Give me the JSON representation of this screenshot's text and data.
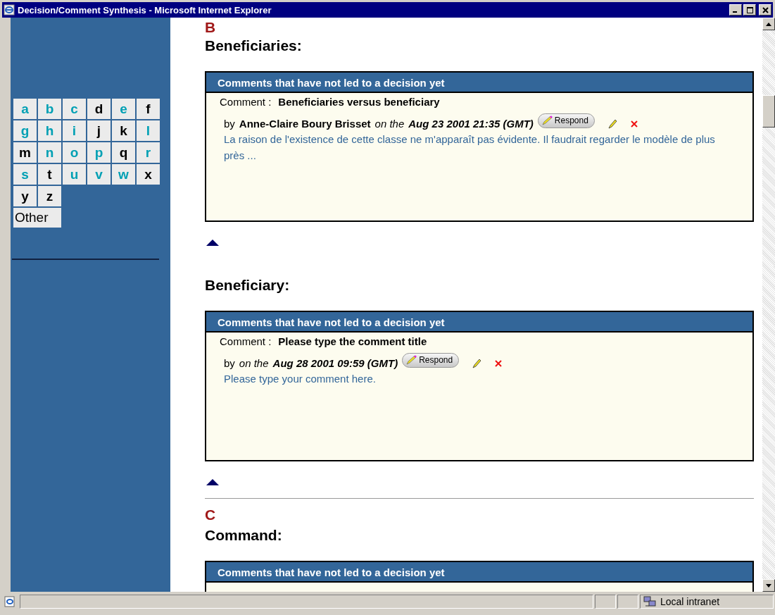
{
  "window": {
    "title": "Decision/Comment Synthesis - Microsoft Internet Explorer"
  },
  "sidebar": {
    "letters": [
      {
        "label": "a",
        "linked": true
      },
      {
        "label": "b",
        "linked": true
      },
      {
        "label": "c",
        "linked": true
      },
      {
        "label": "d",
        "linked": false
      },
      {
        "label": "e",
        "linked": true
      },
      {
        "label": "f",
        "linked": false
      },
      {
        "label": "g",
        "linked": true
      },
      {
        "label": "h",
        "linked": true
      },
      {
        "label": "i",
        "linked": true
      },
      {
        "label": "j",
        "linked": false
      },
      {
        "label": "k",
        "linked": false
      },
      {
        "label": "l",
        "linked": true
      },
      {
        "label": "m",
        "linked": false
      },
      {
        "label": "n",
        "linked": true
      },
      {
        "label": "o",
        "linked": true
      },
      {
        "label": "p",
        "linked": true
      },
      {
        "label": "q",
        "linked": false
      },
      {
        "label": "r",
        "linked": true
      },
      {
        "label": "s",
        "linked": true
      },
      {
        "label": "t",
        "linked": false
      },
      {
        "label": "u",
        "linked": true
      },
      {
        "label": "v",
        "linked": true
      },
      {
        "label": "w",
        "linked": true
      },
      {
        "label": "x",
        "linked": false
      },
      {
        "label": "y",
        "linked": false
      },
      {
        "label": "z",
        "linked": false
      }
    ],
    "other": "Other"
  },
  "sections": [
    {
      "letter": "B",
      "title": "Beneficiaries:",
      "box": {
        "header": "Comments that have not led to a decision yet",
        "comment": {
          "label": "Comment :",
          "title": "Beneficiaries versus beneficiary",
          "by": "by",
          "author": "Anne-Claire Boury Brisset",
          "on": "on the",
          "date": "Aug 23 2001 21:35 (GMT)",
          "respond": "Respond",
          "body": "La raison de l'existence de cette classe ne m'apparaît pas évidente. Il faudrait regarder le modèle de plus près ..."
        }
      }
    },
    {
      "title": "Beneficiary:",
      "box": {
        "header": "Comments that have not led to a decision yet",
        "comment": {
          "label": "Comment :",
          "title": "Please type the comment title",
          "by": "by",
          "on": "on the",
          "date": "Aug 28 2001 09:59 (GMT)",
          "respond": "Respond",
          "body": "Please type your comment here."
        }
      }
    },
    {
      "letter": "C",
      "title": "Command:",
      "box": {
        "header": "Comments that have not led to a decision yet"
      }
    }
  ],
  "status_bar": {
    "zone": "Local intranet"
  }
}
